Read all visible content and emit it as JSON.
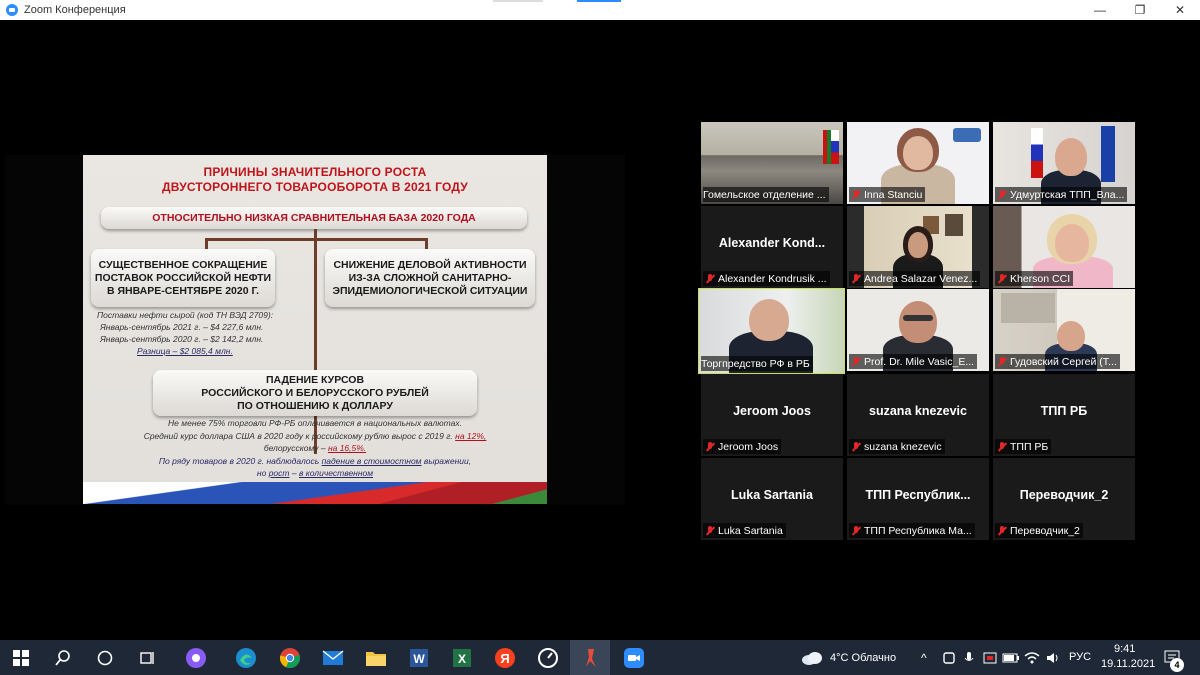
{
  "window": {
    "title": "Zoom Конференция",
    "controls": [
      "—",
      "❐",
      "✕"
    ]
  },
  "slide": {
    "title_line1": "ПРИЧИНЫ ЗНАЧИТЕЛЬНОГО РОСТА",
    "title_line2": "ДВУСТОРОННЕГО ТОВАРООБОРОТА В 2021 ГОДУ",
    "base_box": "ОТНОСИТЕЛЬНО НИЗКАЯ СРАВНИТЕЛЬНАЯ БАЗА 2020 ГОДА",
    "left_box": [
      "СУЩЕСТВЕННОЕ СОКРАЩЕНИЕ",
      "ПОСТАВОК РОССИЙСКОЙ НЕФТИ",
      "В ЯНВАРЕ-СЕНТЯБРЕ 2020 Г."
    ],
    "right_box": [
      "СНИЖЕНИЕ ДЕЛОВОЙ АКТИВНОСТИ",
      "ИЗ-ЗА СЛОЖНОЙ САНИТАРНО-",
      "ЭПИДЕМИОЛОГИЧЕСКОЙ СИТУАЦИИ"
    ],
    "oil_lines": [
      "Поставки нефти сырой (код ТН ВЭД 2709):",
      "Январь-сентябрь 2021 г. – $4 227,6 млн.",
      "Январь-сентябрь 2020 г. – $2 142,2 млн.",
      "Разница – $2 085,4 млн."
    ],
    "bottom_box": [
      "ПАДЕНИЕ КУРСОВ",
      "РОССИЙСКОГО И БЕЛОРУССКОГО РУБЛЕЙ",
      "ПО ОТНОШЕНИЮ К ДОЛЛАРУ"
    ],
    "fx_line1": "Не менее 75% торговли РФ-РБ оплачивается в национальных валютах.",
    "fx_line2_a": "Средний курс доллара США в 2020 году к российскому рублю вырос с 2019 г. ",
    "fx_line2_b": "на 12%,",
    "fx_line3_a": "белорусскому – ",
    "fx_line3_b": "на 16,5%.",
    "fx_line4_a": "По ряду товаров в 2020 г. наблюдалось ",
    "fx_line4_b": "падение в стоимостном",
    "fx_line4_c": " выражении,",
    "fx_line5_a": "но ",
    "fx_line5_b": "рост",
    "fx_line5_c": " – ",
    "fx_line5_d": "в количественном"
  },
  "participants": [
    {
      "label": "Гомельское отделение ...",
      "video": true
    },
    {
      "label": "Inna Stanciu",
      "video": true
    },
    {
      "label": "Удмуртская ТПП_Вла...",
      "video": true
    },
    {
      "label": "Alexander Kondrusik ...",
      "big": "Alexander  Kond...",
      "video": false
    },
    {
      "label": "Andrea Salazar Venez...",
      "video": true
    },
    {
      "label": "Kherson CCI",
      "video": true
    },
    {
      "label": "Торгпредство РФ в РБ",
      "video": true
    },
    {
      "label": "Prof. Dr. Mile Vasic_E...",
      "video": true
    },
    {
      "label": "Гудовский Сергей (Т...",
      "video": true
    },
    {
      "label": "Jeroom Joos",
      "big": "Jeroom Joos",
      "video": false
    },
    {
      "label": "suzana knezevic",
      "big": "suzana knezevic",
      "video": false
    },
    {
      "label": "ТПП РБ",
      "big": "ТПП РБ",
      "video": false
    },
    {
      "label": "Luka Sartania",
      "big": "Luka Sartania",
      "video": false
    },
    {
      "label": "ТПП Республика Ма...",
      "big": "ТПП  Республик...",
      "video": false
    },
    {
      "label": "Переводчик_2",
      "big": "Переводчик_2",
      "video": false
    }
  ],
  "taskbar": {
    "weather": "4°C  Облачно",
    "lang": "РУС",
    "time": "9:41",
    "date": "19.11.2021",
    "notifications": "4"
  }
}
